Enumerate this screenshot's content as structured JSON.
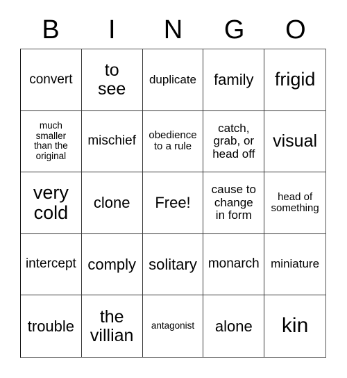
{
  "card": {
    "header": {
      "letters": [
        "B",
        "I",
        "N",
        "G",
        "O"
      ]
    },
    "rows": [
      [
        {
          "text": "convert",
          "size": "sm"
        },
        {
          "text": "to\nsee",
          "size": "lg"
        },
        {
          "text": "duplicate",
          "size": "xs"
        },
        {
          "text": "family",
          "size": "md"
        },
        {
          "text": "frigid",
          "size": "xl"
        }
      ],
      [
        {
          "text": "much\nsmaller\nthan the\noriginal",
          "size": "tiny"
        },
        {
          "text": "mischief",
          "size": "sm"
        },
        {
          "text": "obedience\nto a rule",
          "size": "xxs"
        },
        {
          "text": "catch,\ngrab, or\nhead off",
          "size": "xs"
        },
        {
          "text": "visual",
          "size": "lg"
        }
      ],
      [
        {
          "text": "very\ncold",
          "size": "xl"
        },
        {
          "text": "clone",
          "size": "md"
        },
        {
          "text": "Free!",
          "size": "md"
        },
        {
          "text": "cause to\nchange\nin form",
          "size": "xs"
        },
        {
          "text": "head of\nsomething",
          "size": "xxs"
        }
      ],
      [
        {
          "text": "intercept",
          "size": "sm"
        },
        {
          "text": "comply",
          "size": "md"
        },
        {
          "text": "solitary",
          "size": "md"
        },
        {
          "text": "monarch",
          "size": "sm"
        },
        {
          "text": "miniature",
          "size": "xs"
        }
      ],
      [
        {
          "text": "trouble",
          "size": "md"
        },
        {
          "text": "the\nvillian",
          "size": "lg"
        },
        {
          "text": "antagonist",
          "size": "tiny"
        },
        {
          "text": "alone",
          "size": "md"
        },
        {
          "text": "kin",
          "size": "xxl"
        }
      ]
    ],
    "free_space": {
      "row": 2,
      "col": 2,
      "label": "Free!"
    },
    "colors": {
      "background": "#ffffff",
      "text": "#000000",
      "grid_line": "#3a3a3a"
    }
  }
}
